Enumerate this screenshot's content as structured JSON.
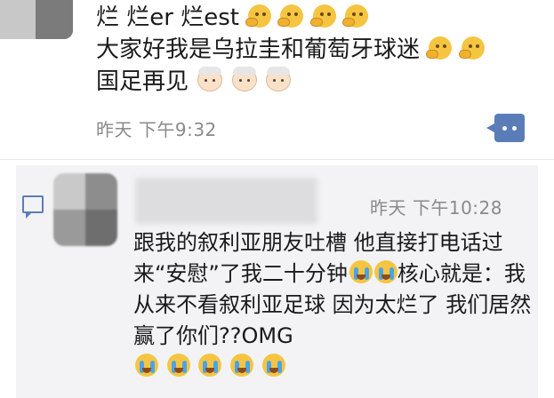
{
  "post": {
    "line1": "烂  烂er  烂est",
    "line2": "大家好我是乌拉圭和葡萄牙球迷",
    "line3": "国足再见",
    "time": "昨天 下午9:32",
    "icons": {
      "thinking": "thinking-face-emoji",
      "old": "older-person-emoji",
      "more": "more-dots-icon"
    }
  },
  "comment": {
    "time": "昨天 下午10:28",
    "text_part1": "跟我的叙利亚朋友吐槽 他直接打电话过来“安慰”了我二十分钟",
    "text_part2": "核心就是：我从来不看叙利亚足球 因为太烂了 我们居然赢了你们??OMG",
    "icons": {
      "comment": "comment-bubble-icon",
      "cry": "loudly-crying-face-emoji"
    }
  }
}
